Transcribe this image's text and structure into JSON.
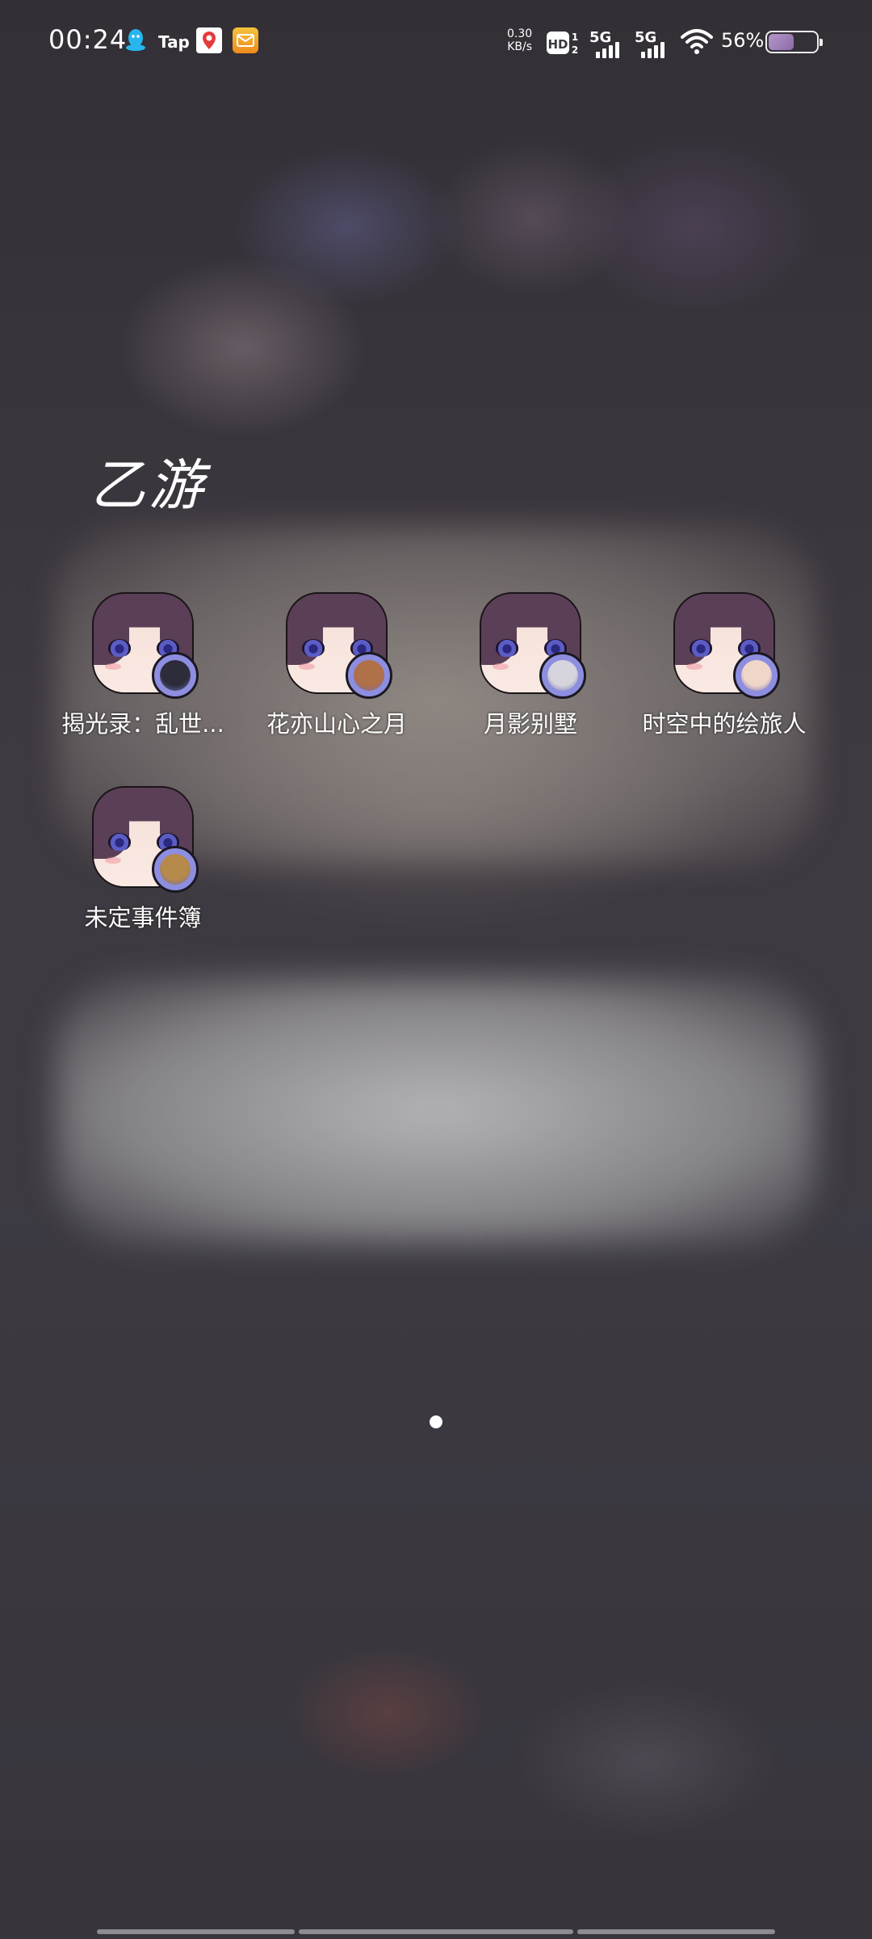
{
  "status_bar": {
    "time": "00:24",
    "notification_icons": [
      "qq-icon",
      "tap-icon",
      "maps-icon",
      "mail-icon"
    ],
    "tap_label": "Tap",
    "net_speed_value": "0.30",
    "net_speed_unit": "KB/s",
    "hd_label": "HD",
    "sim1_label": "5G",
    "sim2_label": "5G",
    "battery_percent": "56%",
    "battery_level": 0.56,
    "battery_color": "#b497cc"
  },
  "folder": {
    "title": "乙游",
    "apps": [
      {
        "label": "揭光录：乱世...",
        "badge_color": "#2d2c3a",
        "icon": "game-app-icon"
      },
      {
        "label": "花亦山心之月",
        "badge_color": "#b07048",
        "icon": "game-app-icon"
      },
      {
        "label": "月影别墅",
        "badge_color": "#d6d4dc",
        "icon": "game-app-icon"
      },
      {
        "label": "时空中的绘旅人",
        "badge_color": "#f0d6c8",
        "icon": "game-app-icon"
      },
      {
        "label": "未定事件簿",
        "badge_color": "#b58a4a",
        "icon": "game-app-icon"
      }
    ]
  },
  "pager": {
    "pages": 1,
    "current": 1
  }
}
